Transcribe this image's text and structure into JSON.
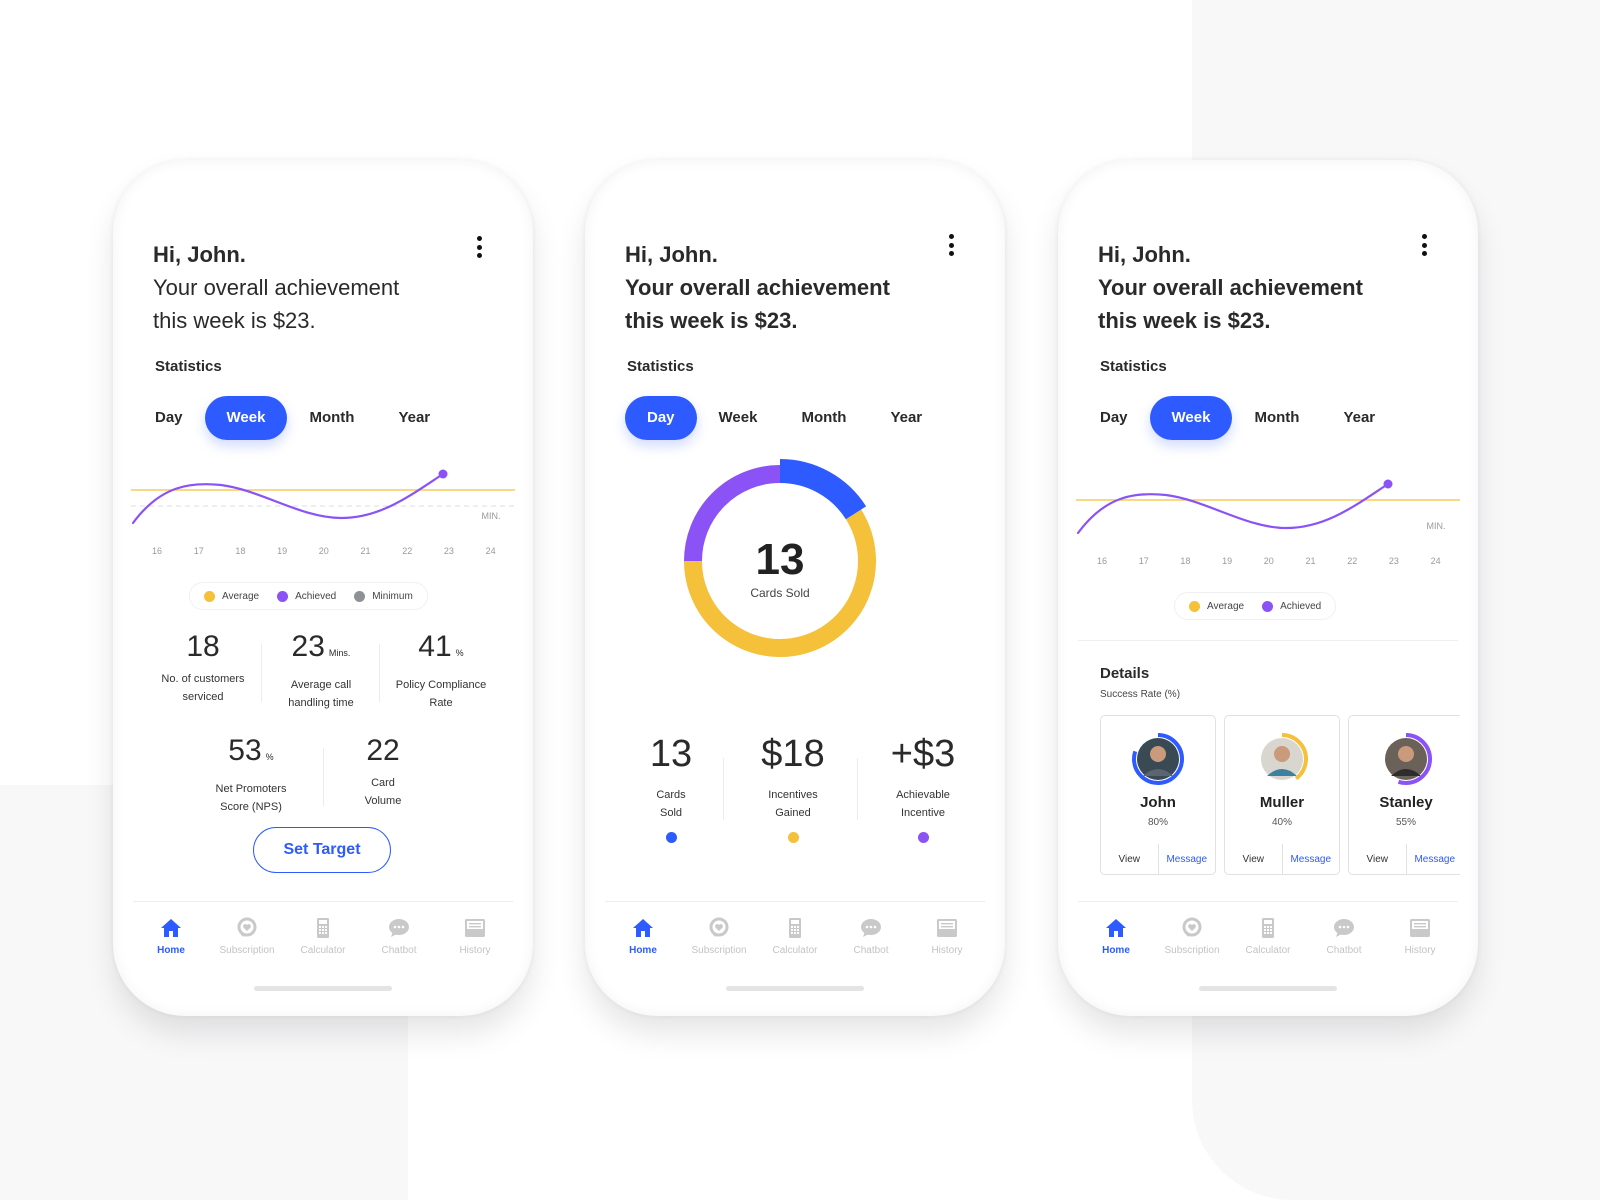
{
  "colors": {
    "primary": "#2d5bff",
    "average": "#f5c03a",
    "achieved": "#8b52f5",
    "minimum": "#8e9196"
  },
  "header": {
    "greeting": "Hi, John.",
    "line1": "Your overall achievement",
    "line2": "this week is $23.",
    "menu_icon": "kebab-menu-icon"
  },
  "statistics_label": "Statistics",
  "tabs": [
    "Day",
    "Week",
    "Month",
    "Year"
  ],
  "phones": [
    {
      "active_tab": "Week",
      "chart": {
        "x_labels": [
          "16",
          "17",
          "18",
          "19",
          "20",
          "21",
          "22",
          "23",
          "24"
        ],
        "min_label": "MIN.",
        "legend": [
          {
            "label": "Average",
            "color": "#f5c03a"
          },
          {
            "label": "Achieved",
            "color": "#8b52f5"
          },
          {
            "label": "Minimum",
            "color": "#8e9196"
          }
        ]
      },
      "metrics": [
        {
          "value": "18",
          "unit": "",
          "label1": "No. of customers",
          "label2": "serviced"
        },
        {
          "value": "23",
          "unit": "Mins.",
          "label1": "Average call",
          "label2": "handling time"
        },
        {
          "value": "41",
          "unit": "%",
          "label1": "Policy Compliance",
          "label2": "Rate"
        },
        {
          "value": "53",
          "unit": "%",
          "label1": "Net Promoters",
          "label2": "Score (NPS)"
        },
        {
          "value": "22",
          "unit": "",
          "label1": "Card",
          "label2": "Volume"
        }
      ],
      "set_target_label": "Set Target"
    },
    {
      "active_tab": "Day",
      "donut": {
        "center_value": "13",
        "center_label": "Cards Sold",
        "segments": [
          {
            "name": "cards-sold",
            "fraction": 0.16,
            "color": "#2d5bff"
          },
          {
            "name": "incentives-gained",
            "fraction": 0.59,
            "color": "#f5c03a"
          },
          {
            "name": "achievable-incentive",
            "fraction": 0.25,
            "color": "#8b52f5"
          }
        ]
      },
      "summary": [
        {
          "value": "13",
          "label1": "Cards",
          "label2": "Sold",
          "color": "#2d5bff"
        },
        {
          "value": "$18",
          "label1": "Incentives",
          "label2": "Gained",
          "color": "#f5c03a"
        },
        {
          "value": "+$3",
          "label1": "Achievable",
          "label2": "Incentive",
          "color": "#8b52f5"
        }
      ]
    },
    {
      "active_tab": "Week",
      "chart": {
        "x_labels": [
          "16",
          "17",
          "18",
          "19",
          "20",
          "21",
          "22",
          "23",
          "24"
        ],
        "min_label": "MIN.",
        "legend": [
          {
            "label": "Average",
            "color": "#f5c03a"
          },
          {
            "label": "Achieved",
            "color": "#8b52f5"
          }
        ]
      },
      "details": {
        "title": "Details",
        "subtitle": "Success Rate (%)",
        "people": [
          {
            "name": "John",
            "rate": "80%",
            "rate_value": 0.8,
            "ring_color": "#2d5bff",
            "view": "View",
            "message": "Message"
          },
          {
            "name": "Muller",
            "rate": "40%",
            "rate_value": 0.4,
            "ring_color": "#f5c03a",
            "view": "View",
            "message": "Message"
          },
          {
            "name": "Stanley",
            "rate": "55%",
            "rate_value": 0.55,
            "ring_color": "#8b52f5",
            "view": "View",
            "message": "Message"
          }
        ]
      }
    }
  ],
  "nav": [
    {
      "label": "Home",
      "icon": "home-icon",
      "active": true
    },
    {
      "label": "Subscription",
      "icon": "subscription-icon",
      "active": false
    },
    {
      "label": "Calculator",
      "icon": "calculator-icon",
      "active": false
    },
    {
      "label": "Chatbot",
      "icon": "chatbot-icon",
      "active": false
    },
    {
      "label": "History",
      "icon": "history-icon",
      "active": false
    }
  ]
}
